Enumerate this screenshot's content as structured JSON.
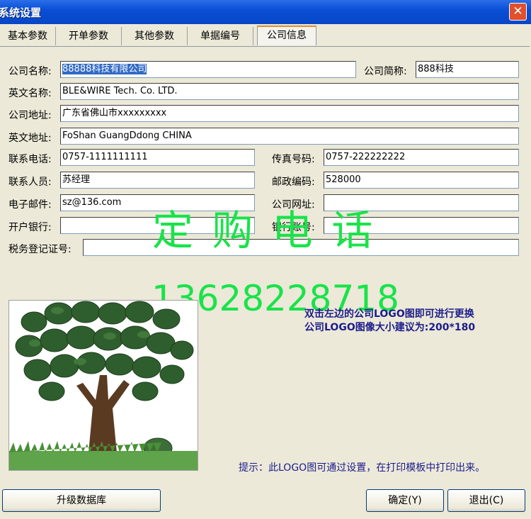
{
  "window": {
    "title": "系统设置",
    "close_glyph": "✕"
  },
  "tabs": [
    "基本参数",
    "开单参数",
    "其他参数",
    "单据编号",
    "公司信息"
  ],
  "form": {
    "company_name": {
      "label": "公司名称:",
      "value": "88888科技有限公司"
    },
    "company_abbr": {
      "label": "公司简称:",
      "value": "888科技"
    },
    "english_name": {
      "label": "英文名称:",
      "value": "BLE&WIRE Tech. Co. LTD."
    },
    "company_address": {
      "label": "公司地址:",
      "value": "广东省佛山市xxxxxxxxx"
    },
    "english_address": {
      "label": "英文地址:",
      "value": "FoShan GuangDdong CHINA"
    },
    "phone": {
      "label": "联系电话:",
      "value": "0757-1111111111"
    },
    "fax": {
      "label": "传真号码:",
      "value": "0757-222222222"
    },
    "contact": {
      "label": "联系人员:",
      "value": "苏经理"
    },
    "postcode": {
      "label": "邮政编码:",
      "value": "528000"
    },
    "email": {
      "label": "电子邮件:",
      "value": "sz@136.com"
    },
    "website": {
      "label": "公司网址:",
      "value": ""
    },
    "bank": {
      "label": "开户银行:",
      "value": ""
    },
    "bank_account": {
      "label": "银行账号:",
      "value": ""
    },
    "tax_id": {
      "label": "税务登记证号:",
      "value": ""
    }
  },
  "watermark": {
    "title": "定 购 电 话",
    "phone": "13628228718",
    "color": "#19e34a"
  },
  "logo_hint": {
    "line1": "双击左边的公司LOGO图即可进行更换",
    "line2": "公司LOGO图像大小建议为:200*180",
    "tip": "提示：此LOGO图可通过设置，在打印模板中打印出来。"
  },
  "buttons": {
    "upgrade": "升级数据库",
    "ok": "确定(Y)",
    "exit": "退出(C)"
  }
}
